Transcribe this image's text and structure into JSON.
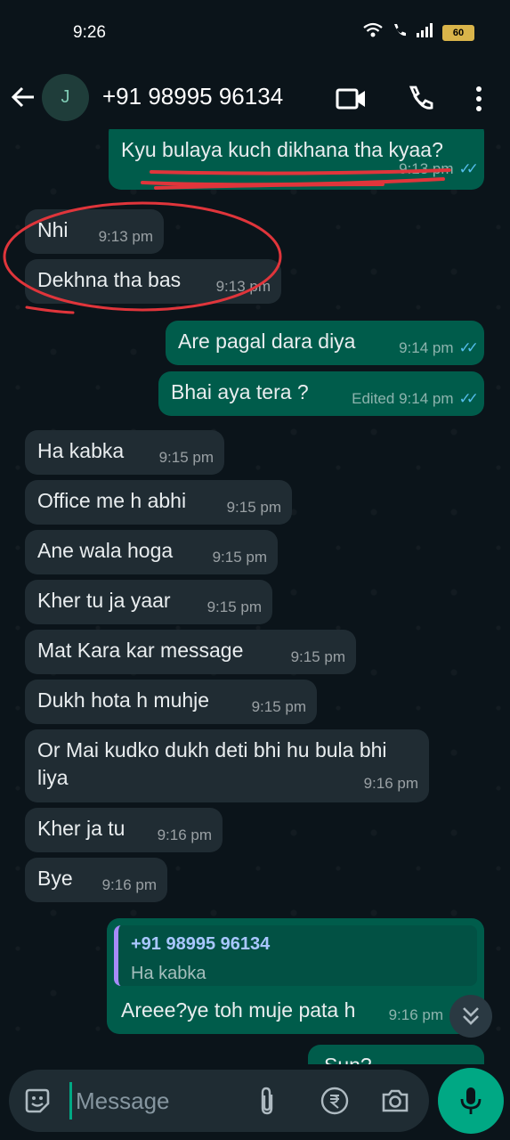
{
  "status_bar": {
    "time": "9:26",
    "battery": "60"
  },
  "header": {
    "avatar_letter": "J",
    "contact_name": "+91 98995 96134"
  },
  "messages": [
    {
      "dir": "out",
      "text": "Kyu bulaya kuch dikhana tha kyaa?",
      "time": "9:13 pm"
    },
    {
      "dir": "in",
      "text": "Nhi",
      "time": "9:13 pm"
    },
    {
      "dir": "in",
      "text": "Dekhna tha bas",
      "time": "9:13 pm"
    },
    {
      "dir": "out",
      "text": "Are pagal dara diya",
      "time": "9:14 pm"
    },
    {
      "dir": "out",
      "text": "Bhai aya tera ?",
      "time": "Edited 9:14 pm"
    },
    {
      "dir": "in",
      "text": "Ha kabka",
      "time": "9:15 pm"
    },
    {
      "dir": "in",
      "text": "Office me h abhi",
      "time": "9:15 pm"
    },
    {
      "dir": "in",
      "text": "Ane wala hoga",
      "time": "9:15 pm"
    },
    {
      "dir": "in",
      "text": "Kher tu ja yaar",
      "time": "9:15 pm"
    },
    {
      "dir": "in",
      "text": "Mat Kara kar message",
      "time": "9:15 pm"
    },
    {
      "dir": "in",
      "text": "Dukh hota h muhje",
      "time": "9:15 pm"
    },
    {
      "dir": "in",
      "text": "Or Mai kudko dukh deti bhi hu bula bhi liya",
      "time": "9:16 pm"
    },
    {
      "dir": "in",
      "text": "Kher ja tu",
      "time": "9:16 pm"
    },
    {
      "dir": "in",
      "text": "Bye",
      "time": "9:16 pm"
    },
    {
      "dir": "out",
      "quote_name": "+91 98995 96134",
      "quote_text": "Ha kabka",
      "text": "Areee?ye toh muje pata h",
      "time": "9:16 pm"
    },
    {
      "dir": "out",
      "text": "Sun?",
      "time": ""
    }
  ],
  "composer": {
    "placeholder": "Message"
  },
  "colors": {
    "background": "#0b141a",
    "incoming": "#202c33",
    "outgoing": "#005c4b",
    "accent": "#00a884",
    "read_ticks": "#53bdeb",
    "annotation": "#e0353b"
  },
  "icons": [
    "back-arrow-icon",
    "video-call-icon",
    "phone-icon",
    "more-options-icon",
    "emoji-icon",
    "attach-icon",
    "rupee-icon",
    "camera-icon",
    "mic-icon",
    "double-chevron-down-icon",
    "wifi-icon",
    "signal-icon",
    "battery-icon"
  ]
}
